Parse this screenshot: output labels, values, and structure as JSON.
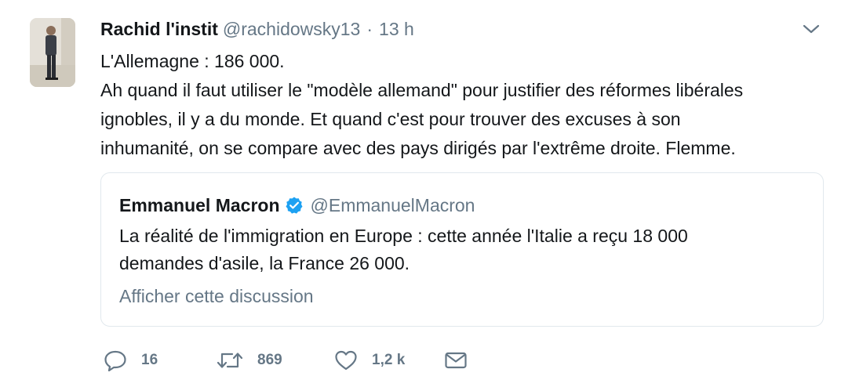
{
  "tweet": {
    "author": {
      "name": "Rachid l'instit",
      "handle": "@rachidowsky13"
    },
    "separator": "·",
    "time": "13 h",
    "text_lines": [
      "L'Allemagne : 186 000.",
      "Ah quand il faut utiliser le \"modèle allemand\" pour justifier des réformes libérales",
      "ignobles, il y a du monde. Et quand c'est pour trouver des excuses à son",
      "inhumanité, on se compare avec des pays dirigés par l'extrême droite. Flemme."
    ]
  },
  "quote": {
    "name": "Emmanuel Macron",
    "handle": "@EmmanuelMacron",
    "verified_icon": "verified-badge-icon",
    "text_lines": [
      "La réalité de l'immigration en Europe : cette année l'Italie a reçu 18 000",
      "demandes d'asile, la France 26 000."
    ],
    "show_thread_label": "Afficher cette discussion"
  },
  "actions": {
    "reply": {
      "icon": "reply-icon",
      "count": "16"
    },
    "retweet": {
      "icon": "retweet-icon",
      "count": "869"
    },
    "like": {
      "icon": "heart-icon",
      "count": "1,2 k"
    },
    "dm": {
      "icon": "envelope-icon"
    }
  },
  "colors": {
    "text": "#14171a",
    "secondary": "#657786",
    "border": "#e1e8ed",
    "verified": "#1da1f2"
  }
}
